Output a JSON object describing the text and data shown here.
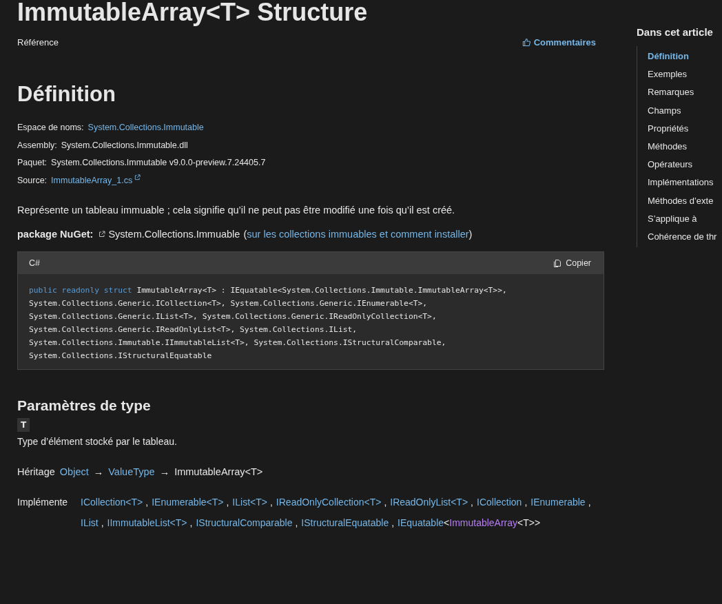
{
  "title": "ImmutableArray<T> Structure",
  "reference_label": "Référence",
  "feedback_link": "Commentaires",
  "definition": {
    "heading": "Définition",
    "facts": [
      {
        "label": "Espace de noms:",
        "value": "System.Collections.Immutable",
        "kind": "link"
      },
      {
        "label": "Assembly:",
        "value": "System.Collections.Immutable.dll",
        "kind": "text"
      },
      {
        "label": "Paquet:",
        "value": "System.Collections.Immutable v9.0.0-preview.7.24405.7",
        "kind": "text"
      },
      {
        "label": "Source:",
        "value": "ImmutableArray_1.cs",
        "kind": "external"
      }
    ]
  },
  "summary": "Représente un tableau immuable ; cela signifie qu’il ne peut pas être modifié une fois qu’il est créé.",
  "nuget": {
    "label": "package NuGet:",
    "package": "System.Collections.Immuable",
    "open_paren": "(",
    "link": "sur les collections immuables et comment installer",
    "close_paren": ")"
  },
  "code_block": {
    "language": "C#",
    "copy_button": "Copier",
    "lines": [
      [
        {
          "kind": "keyword",
          "text": "public readonly struct"
        },
        {
          "kind": "plain",
          "text": " ImmutableArray<T> : IEquatable<System.Collections.Immutable.ImmutableArray<T>>,"
        }
      ],
      [
        {
          "kind": "plain",
          "text": "System.Collections.Generic.ICollection<T>, System.Collections.Generic.IEnumerable<T>,"
        }
      ],
      [
        {
          "kind": "plain",
          "text": "System.Collections.Generic.IList<T>, System.Collections.Generic.IReadOnlyCollection<T>,"
        }
      ],
      [
        {
          "kind": "plain",
          "text": "System.Collections.Generic.IReadOnlyList<T>, System.Collections.IList,"
        }
      ],
      [
        {
          "kind": "plain",
          "text": "System.Collections.Immutable.IImmutableList<T>, System.Collections.IStructuralComparable,"
        }
      ],
      [
        {
          "kind": "plain",
          "text": "System.Collections.IStructuralEquatable"
        }
      ]
    ]
  },
  "type_parameters": {
    "heading": "Paramètres de type",
    "name": "T",
    "description": "Type d’élément stocké par le tableau."
  },
  "inheritance": {
    "label": "Héritage",
    "chain": [
      {
        "text": "Object",
        "kind": "link"
      },
      {
        "text": "→",
        "kind": "arrow"
      },
      {
        "text": "ValueType",
        "kind": "link"
      },
      {
        "text": "→",
        "kind": "arrow"
      },
      {
        "text": "ImmutableArray<T>",
        "kind": "text"
      }
    ]
  },
  "implements": {
    "label": "Implémente",
    "items": [
      [
        {
          "text": "ICollection<T>",
          "kind": "link"
        },
        {
          "text": ",",
          "kind": "text"
        }
      ],
      [
        {
          "text": "IEnumerable<T>",
          "kind": "link"
        },
        {
          "text": ",",
          "kind": "text"
        }
      ],
      [
        {
          "text": "IList<T>",
          "kind": "link"
        },
        {
          "text": ",",
          "kind": "text"
        }
      ],
      [
        {
          "text": "IReadOnlyCollection<T>",
          "kind": "link"
        },
        {
          "text": ",",
          "kind": "text"
        }
      ],
      [
        {
          "text": "IReadOnlyList<T>",
          "kind": "link"
        },
        {
          "text": ",",
          "kind": "text"
        }
      ],
      [
        {
          "text": "ICollection",
          "kind": "link"
        },
        {
          "text": ",",
          "kind": "text"
        }
      ],
      [
        {
          "text": "IEnumerable",
          "kind": "link"
        },
        {
          "text": ",",
          "kind": "text"
        }
      ],
      [
        {
          "text": "IList",
          "kind": "link"
        },
        {
          "text": ",",
          "kind": "text"
        }
      ],
      [
        {
          "text": "IImmutableList<T>",
          "kind": "link"
        },
        {
          "text": ",",
          "kind": "text"
        }
      ],
      [
        {
          "text": "IStructuralComparable",
          "kind": "link"
        },
        {
          "text": ",",
          "kind": "text"
        }
      ],
      [
        {
          "text": "IStructuralEquatable",
          "kind": "link"
        },
        {
          "text": ",",
          "kind": "text"
        }
      ],
      [
        {
          "text": "IEquatable",
          "kind": "link"
        },
        {
          "text": "<",
          "kind": "text"
        },
        {
          "text": "ImmutableArray",
          "kind": "visited"
        },
        {
          "text": "<T>>",
          "kind": "text"
        }
      ]
    ]
  },
  "toc": {
    "heading": "Dans cet article",
    "items": [
      {
        "label": "Définition",
        "selected": true
      },
      {
        "label": "Exemples",
        "selected": false
      },
      {
        "label": "Remarques",
        "selected": false
      },
      {
        "label": "Champs",
        "selected": false
      },
      {
        "label": "Propriétés",
        "selected": false
      },
      {
        "label": "Méthodes",
        "selected": false
      },
      {
        "label": "Opérateurs",
        "selected": false
      },
      {
        "label": "Implémentations",
        "selected": false
      },
      {
        "label": "Méthodes d’exte",
        "selected": false
      },
      {
        "label": "S’applique à",
        "selected": false
      },
      {
        "label": "Cohérence de thr",
        "selected": false
      }
    ]
  }
}
